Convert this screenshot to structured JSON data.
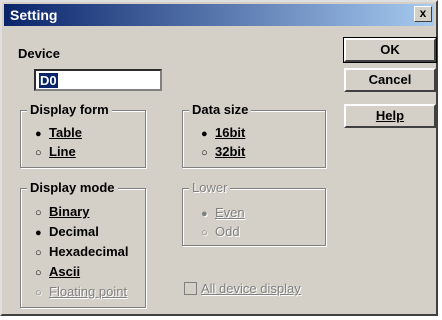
{
  "window": {
    "title": "Setting",
    "close_label": "x"
  },
  "device": {
    "label": "Device",
    "value": "D0"
  },
  "display_form": {
    "title": "Display form",
    "options": [
      {
        "label": "Table",
        "selected": true
      },
      {
        "label": "Line",
        "selected": false
      }
    ]
  },
  "data_size": {
    "title": "Data size",
    "options": [
      {
        "label": "16bit",
        "selected": true
      },
      {
        "label": "32bit",
        "selected": false
      }
    ]
  },
  "display_mode": {
    "title": "Display mode",
    "options": [
      {
        "label": "Binary",
        "selected": false
      },
      {
        "label": "Decimal",
        "selected": true
      },
      {
        "label": "Hexadecimal",
        "selected": false
      },
      {
        "label": "Ascii",
        "selected": false
      },
      {
        "label": "Floating point",
        "selected": false,
        "disabled": true
      }
    ]
  },
  "lower": {
    "title": "Lower",
    "disabled": true,
    "options": [
      {
        "label": "Even",
        "selected": true
      },
      {
        "label": "Odd",
        "selected": false
      }
    ]
  },
  "all_device_display": {
    "label": "All device display",
    "checked": false,
    "disabled": true
  },
  "buttons": {
    "ok": "OK",
    "cancel": "Cancel",
    "help": "Help"
  }
}
